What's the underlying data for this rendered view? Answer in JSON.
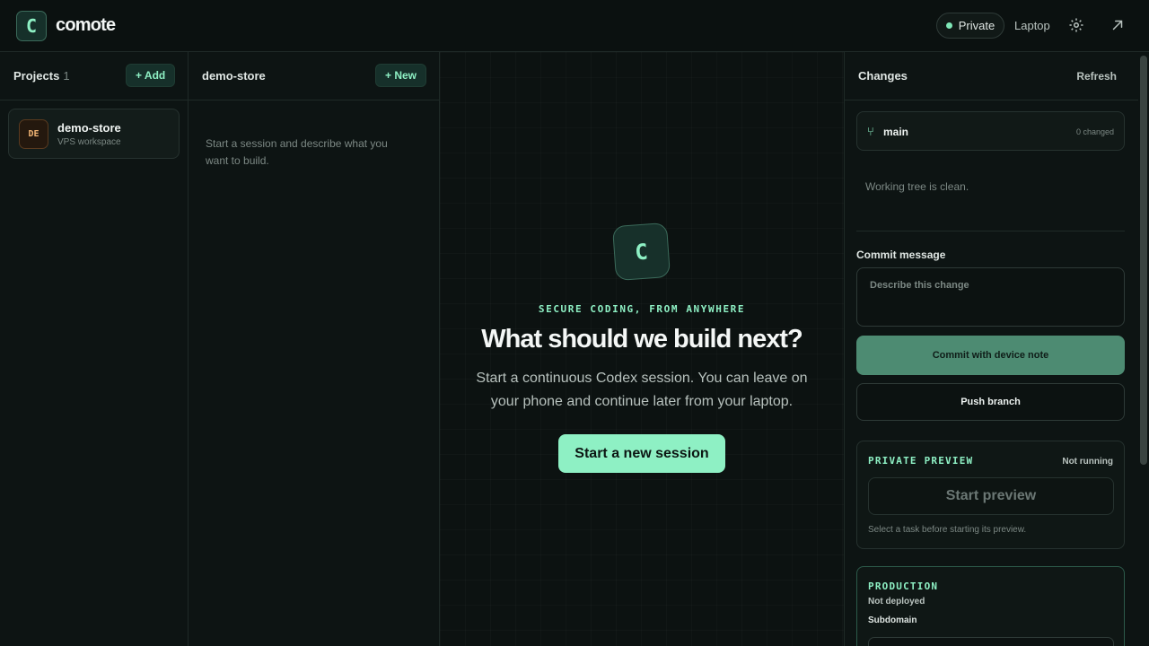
{
  "app": {
    "logo_letter": "C",
    "name": "comote"
  },
  "topbar": {
    "private_label": "Private",
    "device_label": "Laptop",
    "settings_icon": "gear-icon",
    "open_icon": "arrow-up-right-icon"
  },
  "projects": {
    "title": "Projects",
    "count": "1",
    "add_label": "+ Add",
    "items": [
      {
        "avatar": "DE",
        "name": "demo-store",
        "subtitle": "VPS workspace"
      }
    ]
  },
  "sessions": {
    "title": "demo-store",
    "new_label": "+ New",
    "empty_text": "Start a session and describe what you want to build."
  },
  "hero": {
    "logo_letter": "C",
    "kicker": "SECURE CODING, FROM ANYWHERE",
    "title": "What should we build next?",
    "description": "Start a continuous Codex session. You can leave on your phone and continue later from your laptop.",
    "button_label": "Start a new session"
  },
  "changes": {
    "title": "Changes",
    "refresh_label": "Refresh",
    "branch_name": "main",
    "changed_count": "0 changed",
    "tree_status": "Working tree is clean.",
    "commit_label": "Commit message",
    "commit_placeholder": "Describe this change",
    "commit_button": "Commit with device note",
    "push_button": "Push branch",
    "preview": {
      "title": "PRIVATE PREVIEW",
      "status": "Not running",
      "button": "Start preview",
      "note": "Select a task before starting its preview."
    },
    "production": {
      "title": "PRODUCTION",
      "status": "Not deployed",
      "subdomain_label": "Subdomain"
    }
  },
  "colors": {
    "accent": "#8ef0c4",
    "background": "#0c1211",
    "commit_button": "#4d8b72",
    "avatar_text": "#f1b474"
  }
}
